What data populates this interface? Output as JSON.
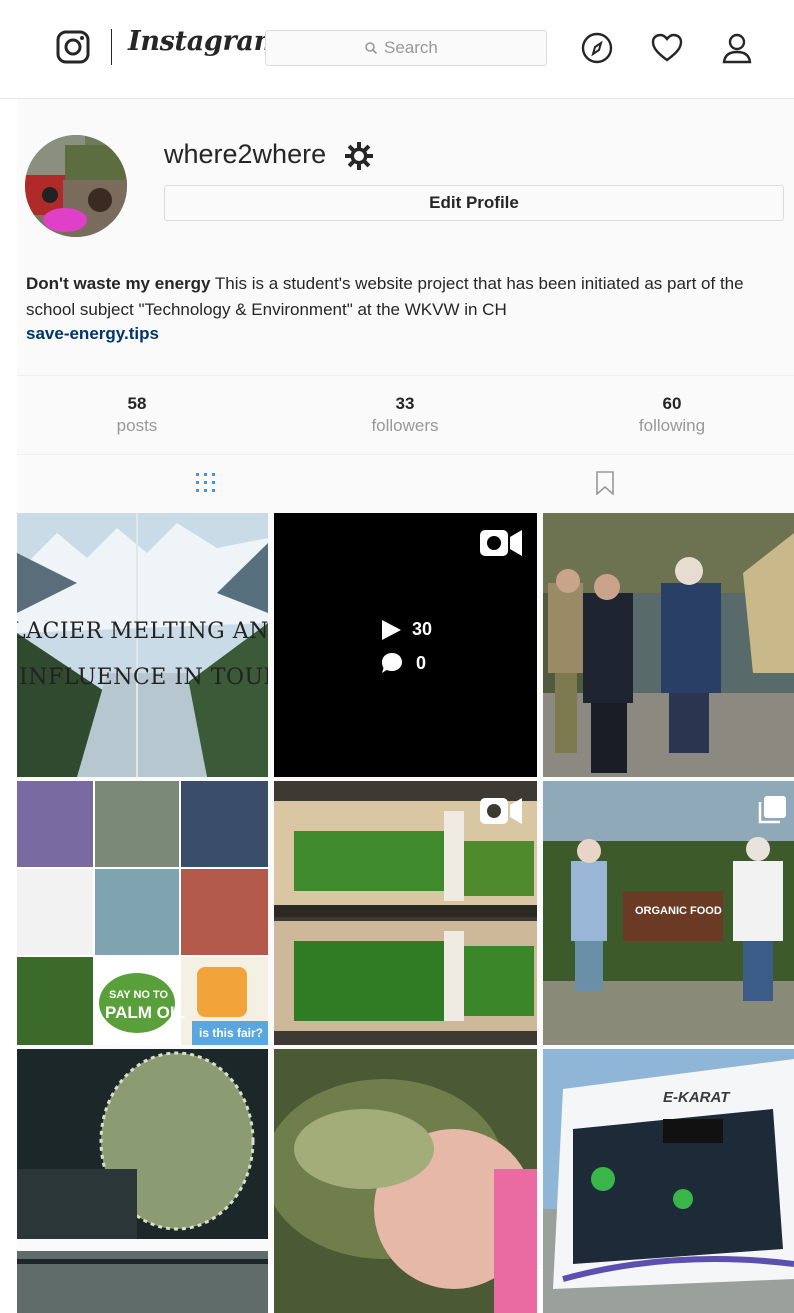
{
  "header": {
    "wordmark": "Instagram",
    "search_placeholder": "Search"
  },
  "profile": {
    "username": "where2where",
    "edit_label": "Edit Profile",
    "bio_name": "Don't waste my energy",
    "bio_text": " This is a student's website project that has been initiated as part of the school subject \"Technology & Environment\" at the WKVW in CH",
    "link": "save-energy.tips"
  },
  "stats": [
    {
      "num": "58",
      "label": "posts"
    },
    {
      "num": "33",
      "label": "followers"
    },
    {
      "num": "60",
      "label": "following"
    }
  ],
  "posts": {
    "glacier_text_1": "LACIER MELTING AND THE",
    "glacier_text_2": "INFLUENCE IN TOURISM",
    "video_views": "30",
    "video_comments": "0",
    "collage_sign_1": "SAY NO TO",
    "collage_sign_2": "PALM OIL",
    "collage_caption": "is this fair?",
    "organic_sign": "ORGANIC FOOD",
    "bus_brand": "E-KARAT"
  },
  "colors": {
    "link": "#003569",
    "border": "#dbdbdb",
    "background": "#fafafa",
    "muted": "#999999",
    "active_tab": "#3897f0"
  },
  "icons": [
    "instagram-camera-icon",
    "search-icon",
    "compass-icon",
    "heart-icon",
    "person-icon",
    "gear-icon",
    "grid-icon",
    "bookmark-icon",
    "video-icon",
    "play-icon",
    "comment-icon",
    "carousel-icon"
  ]
}
